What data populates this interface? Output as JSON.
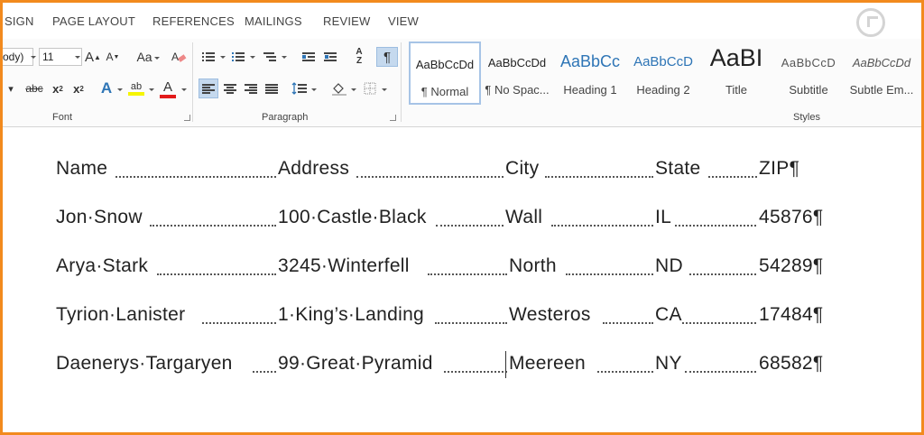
{
  "menu": [
    "SIGN",
    "PAGE LAYOUT",
    "REFERENCES",
    "MAILINGS",
    "REVIEW",
    "VIEW"
  ],
  "ribbon": {
    "font_name": "ody)",
    "font_size": "11",
    "grow_font_label": "A",
    "shrink_font_label": "A",
    "change_case_label": "Aa",
    "strikethrough_label": "abc",
    "subscript_label": "x",
    "subscript_mark": "2",
    "superscript_label": "x",
    "superscript_mark": "2",
    "text_effects_label": "A",
    "highlight_label": "ab",
    "font_color_label": "A",
    "sort_label": "A",
    "sort_label_2": "Z",
    "show_marks_label": "¶",
    "group_font": "Font",
    "group_paragraph": "Paragraph",
    "group_styles": "Styles",
    "colors": {
      "highlight": "#f5f500",
      "font_color": "#e21a1a",
      "accent_blue": "#2e75b6"
    }
  },
  "styles": [
    {
      "sample": "AaBbCcDd",
      "name": "¶ Normal"
    },
    {
      "sample": "AaBbCcDd",
      "name": "¶ No Spac..."
    },
    {
      "sample": "AaBbCc",
      "name": "Heading 1"
    },
    {
      "sample": "AaBbCcD",
      "name": "Heading 2"
    },
    {
      "sample": "AaBI",
      "name": "Title"
    },
    {
      "sample": "AaBbCcD",
      "name": "Subtitle"
    },
    {
      "sample": "AaBbCcDd",
      "name": "Subtle Em..."
    }
  ],
  "document": {
    "rows": [
      [
        "Name",
        "Address",
        "City",
        "State",
        "ZIP¶"
      ],
      [
        "Jon·Snow",
        "100·Castle·Black",
        "Wall",
        "IL",
        "45876¶"
      ],
      [
        "Arya·Stark",
        "3245·Winterfell",
        "North",
        "ND",
        "54289¶"
      ],
      [
        "Tyrion·Lanister",
        "1·King’s·Landing",
        "Westeros",
        "CA",
        "17484¶"
      ],
      [
        "Daenerys·Targaryen",
        "99·Great·Pyramid",
        "Meereen",
        "NY",
        "68582¶"
      ]
    ]
  }
}
